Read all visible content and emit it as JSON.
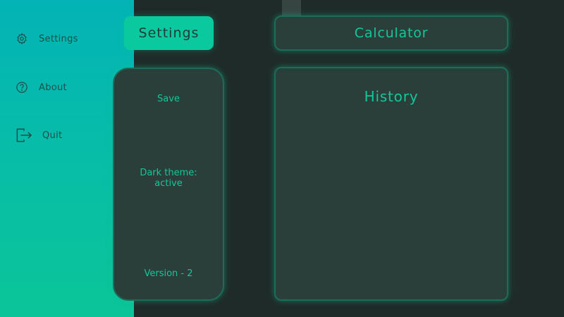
{
  "sidebar": {
    "items": [
      {
        "label": "Settings",
        "icon": "gear-icon"
      },
      {
        "label": "About",
        "icon": "question-circle-icon"
      },
      {
        "label": "Quit",
        "icon": "exit-icon"
      }
    ]
  },
  "tabs": {
    "settings": "Settings",
    "calculator": "Calculator"
  },
  "settings_panel": {
    "save_label": "Save",
    "theme_line1": "Dark theme:",
    "theme_line2": "active",
    "version": "Version  - 2"
  },
  "history": {
    "title": "History"
  },
  "colors": {
    "accent": "#12c79c",
    "background": "#1f2b28",
    "panel": "#2a3f39"
  }
}
